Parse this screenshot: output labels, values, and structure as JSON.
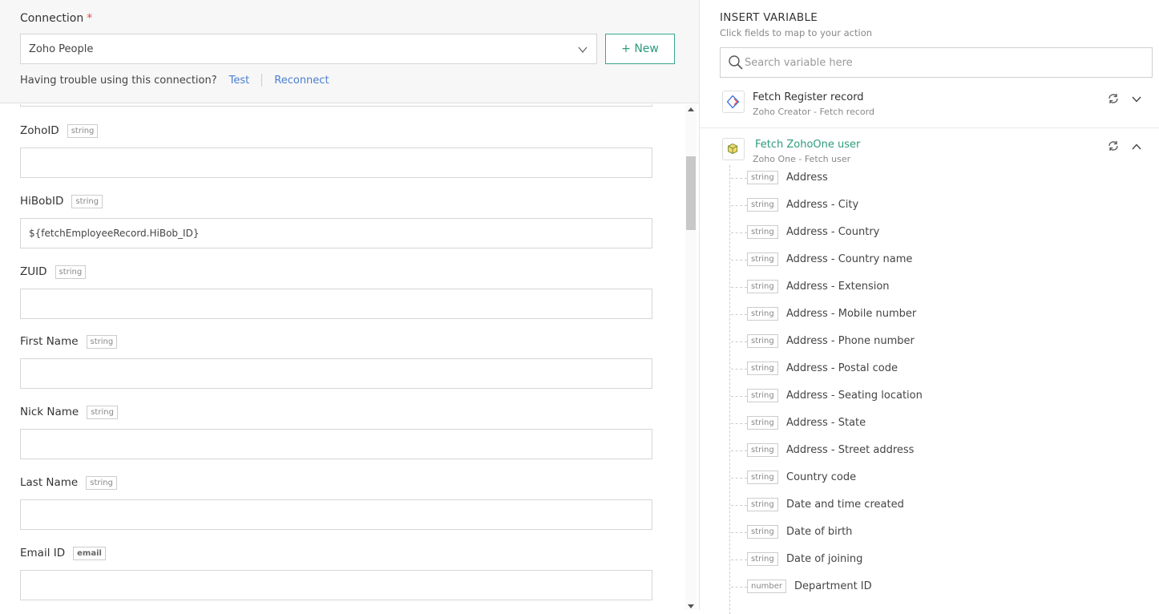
{
  "connection": {
    "label": "Connection",
    "required_mark": "*",
    "selected": "Zoho People",
    "new_button": "+ New",
    "trouble_text": "Having trouble using this connection?",
    "test_link": "Test",
    "reconnect_link": "Reconnect"
  },
  "fields": [
    {
      "label": "ZohoID",
      "type": "string",
      "value": ""
    },
    {
      "label": "HiBobID",
      "type": "string",
      "value": "${fetchEmployeeRecord.HiBob_ID}"
    },
    {
      "label": "ZUID",
      "type": "string",
      "value": ""
    },
    {
      "label": "First Name",
      "type": "string",
      "value": ""
    },
    {
      "label": "Nick Name",
      "type": "string",
      "value": ""
    },
    {
      "label": "Last Name",
      "type": "string",
      "value": ""
    },
    {
      "label": "Email ID",
      "type": "email",
      "value": ""
    }
  ],
  "insert_variable": {
    "title": "INSERT VARIABLE",
    "subtitle": "Click fields to map to your action",
    "search_placeholder": "Search variable here",
    "sources": [
      {
        "title": "Fetch Register record",
        "subtitle": "Zoho Creator - Fetch record",
        "expanded": false
      },
      {
        "title": "Fetch ZohoOne user",
        "subtitle": "Zoho One -  Fetch user",
        "expanded": true
      }
    ],
    "variables": [
      {
        "type": "string",
        "name": "Address"
      },
      {
        "type": "string",
        "name": "Address - City"
      },
      {
        "type": "string",
        "name": "Address - Country"
      },
      {
        "type": "string",
        "name": "Address - Country name"
      },
      {
        "type": "string",
        "name": "Address - Extension"
      },
      {
        "type": "string",
        "name": "Address - Mobile number"
      },
      {
        "type": "string",
        "name": "Address - Phone number"
      },
      {
        "type": "string",
        "name": "Address - Postal code"
      },
      {
        "type": "string",
        "name": "Address - Seating location"
      },
      {
        "type": "string",
        "name": "Address - State"
      },
      {
        "type": "string",
        "name": "Address - Street address"
      },
      {
        "type": "string",
        "name": "Country code"
      },
      {
        "type": "string",
        "name": "Date and time created"
      },
      {
        "type": "string",
        "name": "Date of birth"
      },
      {
        "type": "string",
        "name": "Date of joining"
      },
      {
        "type": "number",
        "name": "Department ID"
      }
    ]
  },
  "colors": {
    "accent": "#2d9b7c",
    "link": "#4a7fd1",
    "required": "#e54d4d"
  }
}
